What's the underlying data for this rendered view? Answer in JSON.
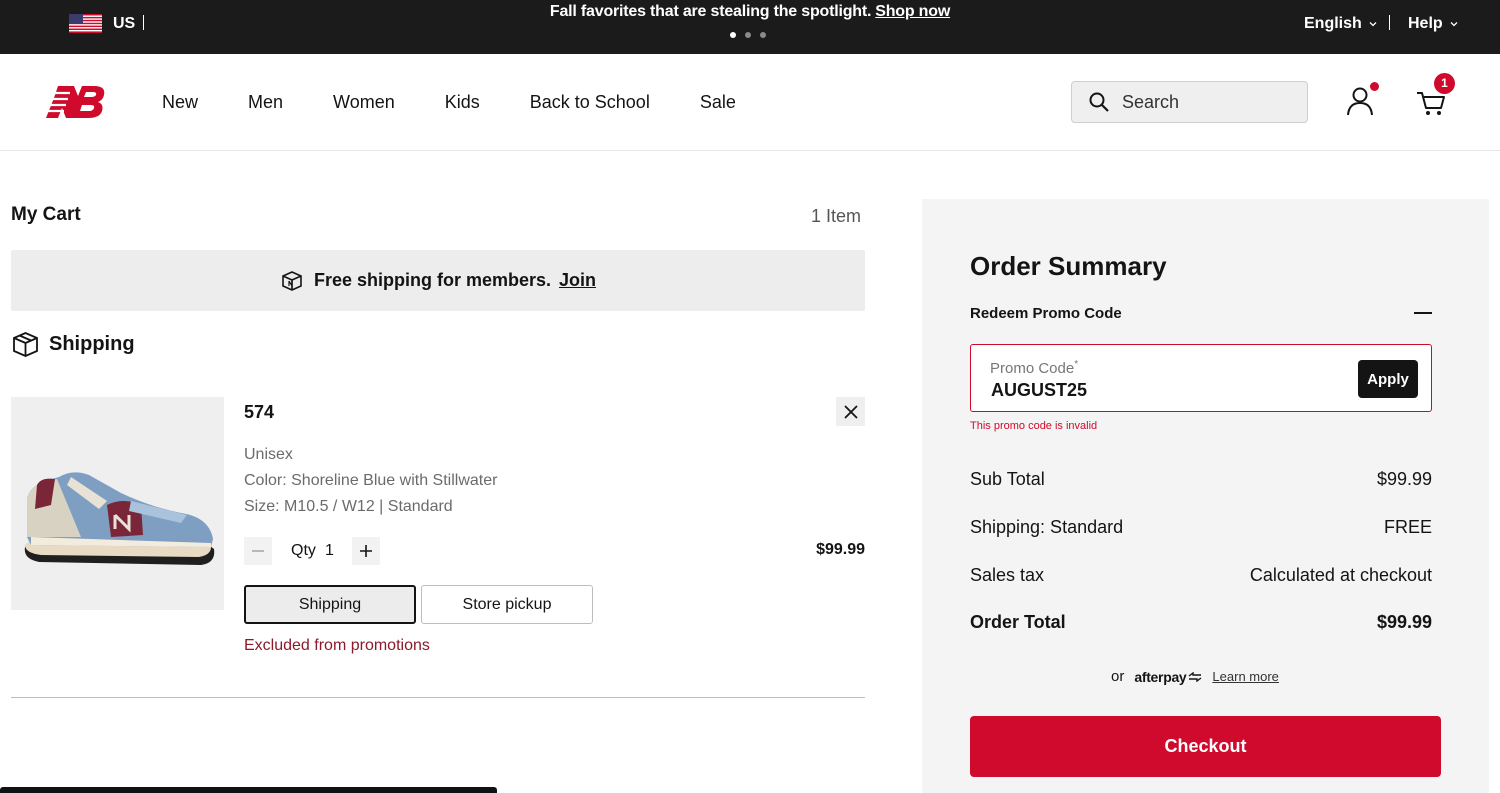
{
  "topbar": {
    "region": "US",
    "promo_text": "Fall favorites that are stealing the spotlight.",
    "promo_link": "Shop now",
    "language": "English",
    "help": "Help"
  },
  "header": {
    "nav": [
      "New",
      "Men",
      "Women",
      "Kids",
      "Back to School",
      "Sale"
    ],
    "search_placeholder": "Search",
    "cart_count": "1"
  },
  "cart": {
    "title": "My Cart",
    "item_count": "1 Item",
    "member_banner": "Free shipping for members.",
    "member_link": "Join",
    "shipping_heading": "Shipping",
    "product": {
      "name": "574",
      "gender": "Unisex",
      "color": "Color: Shoreline Blue with Stillwater",
      "size": "Size: M10.5 / W12 | Standard",
      "qty_label": "Qty",
      "qty": "1",
      "price": "$99.99",
      "shipping_option": "Shipping",
      "pickup_option": "Store pickup",
      "promo_note": "Excluded from promotions"
    }
  },
  "summary": {
    "title": "Order Summary",
    "promo_label": "Redeem Promo Code",
    "promo_placeholder": "Promo Code",
    "promo_required": "*",
    "promo_value": "AUGUST25",
    "apply": "Apply",
    "promo_error": "This promo code is invalid",
    "subtotal_label": "Sub Total",
    "subtotal_value": "$99.99",
    "shipping_label": "Shipping: Standard",
    "shipping_value": "FREE",
    "tax_label": "Sales tax",
    "tax_value": "Calculated at checkout",
    "total_label": "Order Total",
    "total_value": "$99.99",
    "afterpay_or": "or",
    "afterpay_brand": "afterpay",
    "afterpay_learn": "Learn more",
    "checkout": "Checkout"
  },
  "colors": {
    "brand_red": "#cf0a2c",
    "topbar_bg": "#1b1b1b",
    "error_text": "#8b1a2b"
  }
}
